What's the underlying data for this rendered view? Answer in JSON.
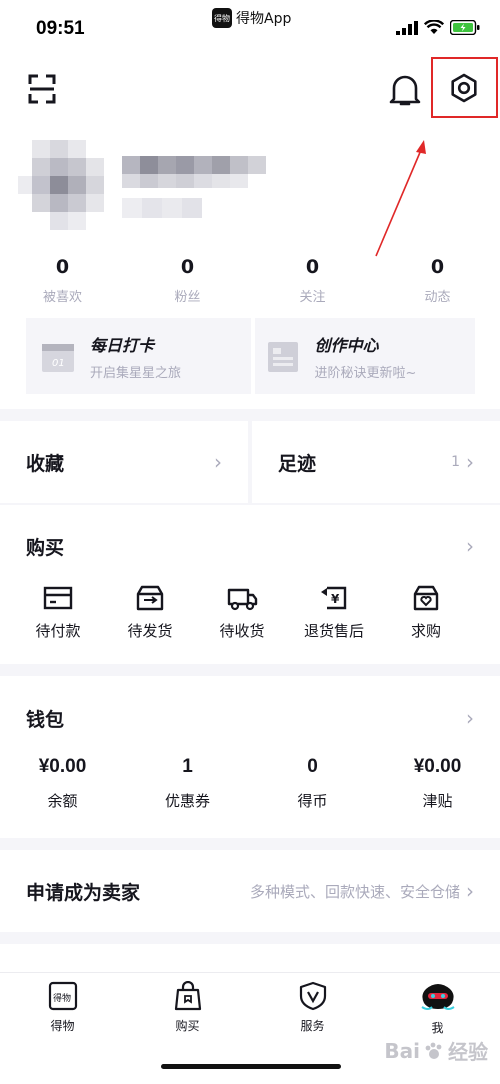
{
  "status_bar": {
    "time": "09:51",
    "app_name": "得物App",
    "app_badge": "得物"
  },
  "header": {
    "scan_icon": "scan-icon",
    "bell_icon": "bell-icon",
    "settings_icon": "gear-icon",
    "highlight_color": "#e02828"
  },
  "stats": [
    {
      "value": "0",
      "label": "被喜欢"
    },
    {
      "value": "0",
      "label": "粉丝"
    },
    {
      "value": "0",
      "label": "关注"
    },
    {
      "value": "0",
      "label": "动态"
    }
  ],
  "cards": [
    {
      "title": "每日打卡",
      "subtitle": "开启集星星之旅",
      "icon": "calendar-icon",
      "icon_text": "01"
    },
    {
      "title": "创作中心",
      "subtitle": "进阶秘诀更新啦~",
      "icon": "document-icon"
    }
  ],
  "collect": {
    "label": "收藏"
  },
  "footprint": {
    "label": "足迹",
    "count": "1"
  },
  "purchase": {
    "title": "购买",
    "items": [
      {
        "label": "待付款",
        "icon": "card-icon"
      },
      {
        "label": "待发货",
        "icon": "box-icon"
      },
      {
        "label": "待收货",
        "icon": "truck-icon"
      },
      {
        "label": "退货售后",
        "icon": "refund-icon",
        "icon_text": "¥"
      },
      {
        "label": "求购",
        "icon": "heart-box-icon"
      }
    ]
  },
  "wallet": {
    "title": "钱包",
    "items": [
      {
        "value": "¥0.00",
        "label": "余额"
      },
      {
        "value": "1",
        "label": "优惠券"
      },
      {
        "value": "0",
        "label": "得币"
      },
      {
        "value": "¥0.00",
        "label": "津贴"
      }
    ]
  },
  "seller": {
    "title": "申请成为卖家",
    "subtitle": "多种模式、回款快速、安全仓储"
  },
  "tabs": [
    {
      "label": "得物",
      "icon": "dewu-icon",
      "icon_text": "得物"
    },
    {
      "label": "购买",
      "icon": "shopping-bag-icon"
    },
    {
      "label": "服务",
      "icon": "shield-icon"
    },
    {
      "label": "我",
      "icon": "avatar-icon"
    }
  ],
  "watermark": {
    "text": "Bai",
    "suffix": "经验"
  },
  "colors": {
    "text": "#16161e",
    "muted": "#aaaabb",
    "separator": "#f5f5f9"
  }
}
